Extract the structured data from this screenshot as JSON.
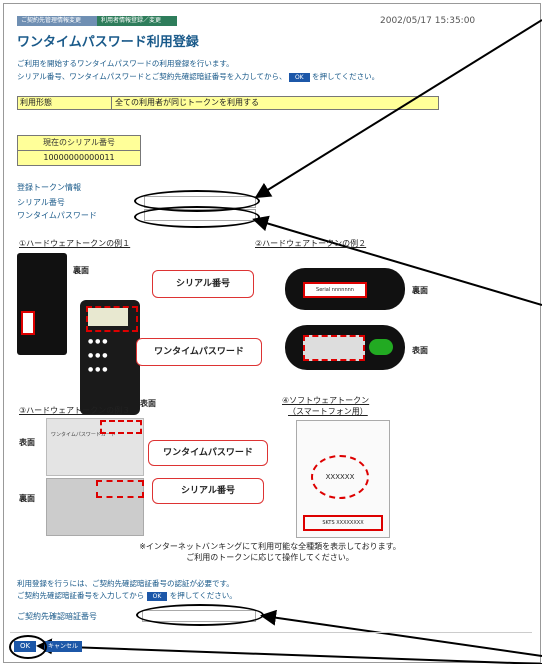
{
  "breadcrumbs": [
    "ご契約先管理情報変更",
    "利用者情報登録／変更"
  ],
  "timestamp": "2002/05/17 15:35:00",
  "title": "ワンタイムパスワード利用登録",
  "desc1": "ご利用を開始するワンタイムパスワードの利用登録を行います。",
  "desc2a": "シリアル番号、ワンタイムパスワードとご契約先確認暗証番号を入力してから、",
  "ok_label": "OK",
  "desc2b": "を押してください。",
  "usage": {
    "label": "利用形態",
    "value": "全ての利用者が同じトークンを利用する"
  },
  "serial_box": {
    "header": "現在のシリアル番号",
    "value": "10000000000011"
  },
  "token_info": {
    "title": "登録トークン情報",
    "serial_label": "シリアル番号",
    "otp_label": "ワンタイムパスワード"
  },
  "examples": {
    "hw1": "①ハードウェアトークンの例１",
    "hw2": "②ハードウェアトークンの例２",
    "hw3": "③ハードウェアトークンの例３",
    "sw": "④ソフトウェアトークン",
    "sw_sub": "（スマートフォン用）",
    "back": "裏面",
    "front": "表面",
    "serial": "シリアル番号",
    "otp": "ワンタイムパスワード",
    "serial_sample": "Serial nnnnnnn",
    "otp_sample": "XXXXXX",
    "sw_serial": "SKTS XXXXXXXX",
    "card_title": "ワンタイムパスワードカード"
  },
  "note1": "※インターネットバンキングにて利用可能な全種類を表示しております。",
  "note2": "ご利用のトークンに応じて操作してください。",
  "footer1": "利用登録を行うには、ご契約先確認暗証番号の認証が必要です。",
  "footer2a": "ご契約先確認暗証番号を入力してから",
  "footer2b": "を押してください。",
  "pin_label": "ご契約先確認暗証番号",
  "buttons": {
    "ok": "OK",
    "cancel": "キャンセル"
  }
}
